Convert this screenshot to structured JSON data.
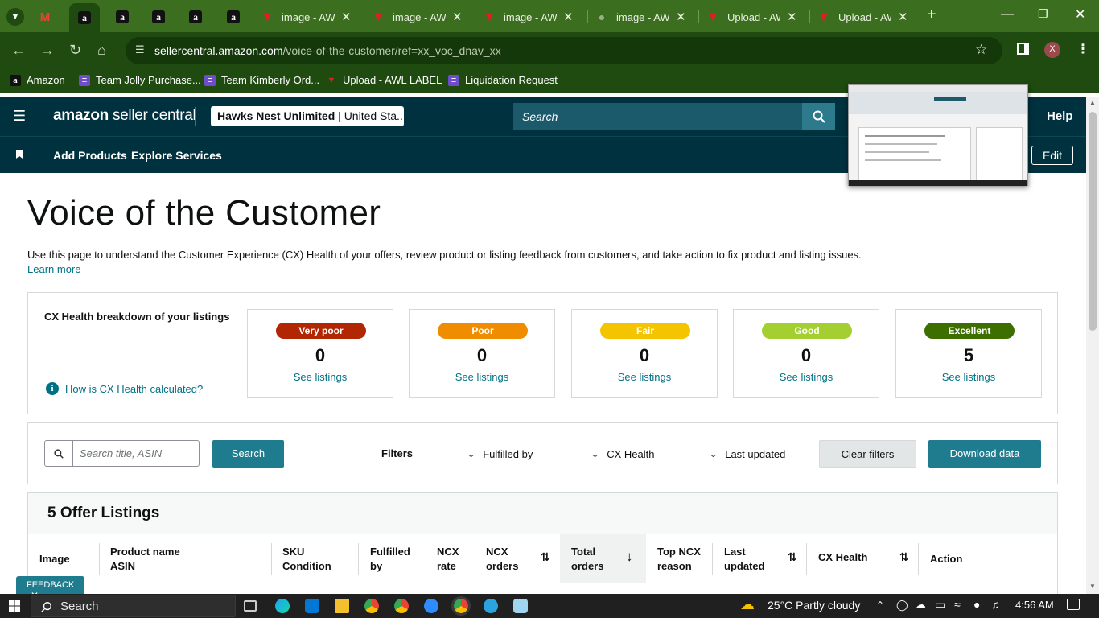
{
  "browser": {
    "tabs": [
      {
        "title": "",
        "favicon": "gmail-icon"
      },
      {
        "title": "",
        "favicon": "amazon-icon"
      },
      {
        "title": "",
        "favicon": "amazon-icon"
      },
      {
        "title": "",
        "favicon": "amazon-icon"
      },
      {
        "title": "",
        "favicon": "amazon-icon"
      },
      {
        "title": "",
        "favicon": "amazon-icon"
      },
      {
        "title": "image - AWL",
        "favicon": "awl-icon"
      },
      {
        "title": "image - AWL",
        "favicon": "awl-icon"
      },
      {
        "title": "image - AWL",
        "favicon": "awl-icon"
      },
      {
        "title": "image - AWL",
        "favicon": "globe-icon"
      },
      {
        "title": "Upload - AW",
        "favicon": "awl-icon"
      },
      {
        "title": "Upload - AW",
        "favicon": "awl-icon"
      }
    ],
    "url_domain": "sellercentral.amazon.com",
    "url_path": "/voice-of-the-customer/ref=xx_voc_dnav_xx",
    "profile_initial": "X",
    "bookmarks": [
      {
        "label": "Amazon",
        "icon": "amazon-icon"
      },
      {
        "label": "Team Jolly Purchase...",
        "icon": "forms-icon"
      },
      {
        "label": "Team Kimberly Ord...",
        "icon": "forms-icon"
      },
      {
        "label": "Upload - AWL LABEL",
        "icon": "awl-icon"
      },
      {
        "label": "Liquidation Request",
        "icon": "forms-icon"
      }
    ]
  },
  "seller_central": {
    "logo_brand": "amazon",
    "logo_product": "seller central",
    "account_name": "Hawks Nest Unlimited",
    "account_region": "United Sta...",
    "search_placeholder": "Search",
    "help_label": "Help",
    "nav_links": [
      "Add Products",
      "Explore Services"
    ],
    "edit_label": "Edit"
  },
  "page": {
    "title": "Voice of the Customer",
    "description": "Use this page to understand the Customer Experience (CX) Health of your offers, review product or listing feedback from customers, and take action to fix product and listing issues.",
    "learn_more": "Learn more"
  },
  "cx_health": {
    "label": "CX Health breakdown of your listings",
    "how_link": "How is CX Health calculated?",
    "cards": [
      {
        "label": "Very poor",
        "count": "0",
        "link": "See listings",
        "color": "#b12704",
        "text_color": "#ffffff"
      },
      {
        "label": "Poor",
        "count": "0",
        "link": "See listings",
        "color": "#f08c00",
        "text_color": "#ffffff"
      },
      {
        "label": "Fair",
        "count": "0",
        "link": "See listings",
        "color": "#f5c400",
        "text_color": "#ffffff"
      },
      {
        "label": "Good",
        "count": "0",
        "link": "See listings",
        "color": "#a4cf30",
        "text_color": "#ffffff"
      },
      {
        "label": "Excellent",
        "count": "5",
        "link": "See listings",
        "color": "#3c6e00",
        "text_color": "#ffffff"
      }
    ]
  },
  "filters": {
    "search_placeholder": "Search title, ASIN",
    "search_button": "Search",
    "label": "Filters",
    "dropdowns": [
      "Fulfilled by",
      "CX Health",
      "Last updated"
    ],
    "clear_button": "Clear filters",
    "download_button": "Download data"
  },
  "listings": {
    "title": "5 Offer Listings",
    "columns": [
      {
        "line1": "Image",
        "line2": ""
      },
      {
        "line1": "Product name",
        "line2": "ASIN"
      },
      {
        "line1": "SKU",
        "line2": "Condition"
      },
      {
        "line1": "Fulfilled",
        "line2": "by"
      },
      {
        "line1": "NCX",
        "line2": "rate"
      },
      {
        "line1": "NCX",
        "line2": "orders"
      },
      {
        "line1": "Total",
        "line2": "orders"
      },
      {
        "line1": "Top NCX",
        "line2": "reason"
      },
      {
        "line1": "Last",
        "line2": "updated"
      },
      {
        "line1": "CX Health",
        "line2": ""
      },
      {
        "line1": "Action",
        "line2": ""
      }
    ]
  },
  "feedback_label": "FEEDBACK",
  "taskbar": {
    "search_label": "Search",
    "weather_temp": "25°C",
    "weather_desc": "Partly cloudy",
    "time": "4:56 AM"
  }
}
